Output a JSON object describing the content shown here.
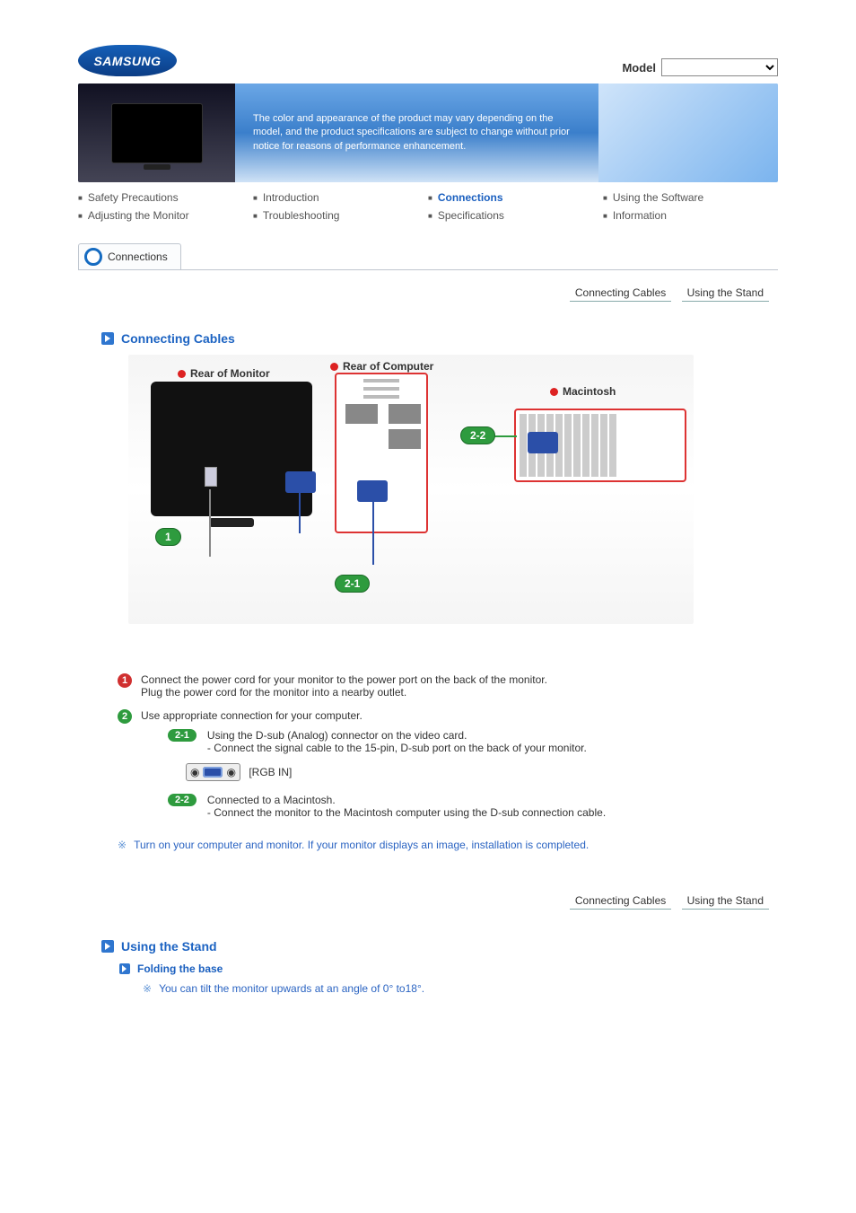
{
  "brand": "SAMSUNG",
  "model_label": "Model",
  "hero_text": "The color and appearance of the product may vary depending on the model, and the product specifications are subject to change without prior notice for reasons of performance enhancement.",
  "nav": {
    "safety": "Safety Precautions",
    "introduction": "Introduction",
    "connections": "Connections",
    "using_software": "Using the Software",
    "adjusting": "Adjusting the Monitor",
    "troubleshooting": "Troubleshooting",
    "specifications": "Specifications",
    "information": "Information"
  },
  "section_tab": "Connections",
  "sublinks": {
    "connecting_cables": "Connecting Cables",
    "using_stand": "Using the Stand"
  },
  "headings": {
    "connecting_cables": "Connecting Cables",
    "using_stand": "Using the Stand"
  },
  "diagram": {
    "rear_monitor": "Rear of Monitor",
    "rear_computer": "Rear of Computer",
    "macintosh": "Macintosh",
    "callout_1": "1",
    "callout_21": "2-1",
    "callout_22": "2-2"
  },
  "steps": {
    "s1a": "Connect the power cord for your monitor to the power port on the back of the monitor.",
    "s1b": "Plug the power cord for the monitor into a nearby outlet.",
    "s2": "Use appropriate connection for your computer.",
    "s21_bullet": "2-1",
    "s21a": "Using the D-sub (Analog) connector on the video card.",
    "s21b": "- Connect the signal cable to the 15-pin, D-sub port on the back of your monitor.",
    "port_label": "[RGB IN]",
    "s22_bullet": "2-2",
    "s22a": "Connected to a Macintosh.",
    "s22b": "- Connect the monitor to the Macintosh computer using the D-sub connection cable.",
    "completion_note": "Turn on your computer and monitor. If your monitor displays an image, installation is completed."
  },
  "stand": {
    "folding_title": "Folding the base",
    "tilt_note": "You can tilt the monitor upwards at an angle of 0° to18°."
  }
}
